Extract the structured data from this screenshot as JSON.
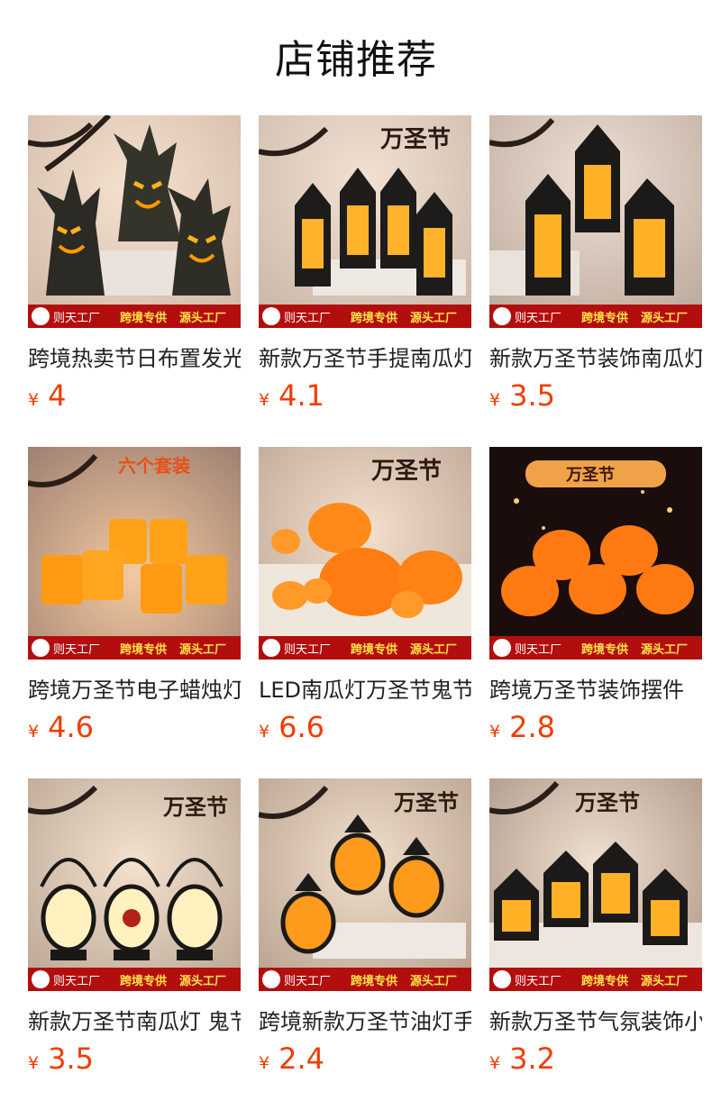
{
  "header": {
    "title": "店铺推荐"
  },
  "banner": {
    "brand": "则天工厂",
    "slogan1": "跨境专供",
    "slogan2": "源头工厂"
  },
  "colors": {
    "price": "#f23c00",
    "banner_red": "#b30e0e",
    "banner_text": "#ffe34a"
  },
  "products": [
    {
      "title": "跨境热卖节日布置发光树桩摆件",
      "currency": "¥",
      "price": "4",
      "overlay": "",
      "icon": "tree-stump-lights-icon"
    },
    {
      "title": "新款万圣节手提南瓜灯装饰",
      "currency": "¥",
      "price": "4.1",
      "overlay": "万圣节",
      "icon": "lantern-icon"
    },
    {
      "title": "新款万圣节装饰南瓜灯挂件",
      "currency": "¥",
      "price": "3.5",
      "overlay": "",
      "icon": "lantern-icon"
    },
    {
      "title": "跨境万圣节电子蜡烛灯套装",
      "currency": "¥",
      "price": "4.6",
      "overlay": "六个套装",
      "icon": "candle-icon"
    },
    {
      "title": "LED南瓜灯万圣节鬼节装饰",
      "currency": "¥",
      "price": "6.6",
      "overlay": "万圣节",
      "icon": "pumpkin-icon"
    },
    {
      "title": "跨境万圣节装饰摆件",
      "currency": "¥",
      "price": "2.8",
      "overlay": "万圣节",
      "icon": "pumpkin-icon"
    },
    {
      "title": "新款万圣节南瓜灯 鬼节手提灯",
      "currency": "¥",
      "price": "3.5",
      "overlay": "万圣节",
      "icon": "oil-lamp-icon"
    },
    {
      "title": "跨境新款万圣节油灯手提灯",
      "currency": "¥",
      "price": "2.4",
      "overlay": "万圣节",
      "icon": "oil-lamp-icon"
    },
    {
      "title": "新款万圣节气氛装饰小屋灯",
      "currency": "¥",
      "price": "3.2",
      "overlay": "万圣节",
      "icon": "house-lamp-icon"
    }
  ]
}
